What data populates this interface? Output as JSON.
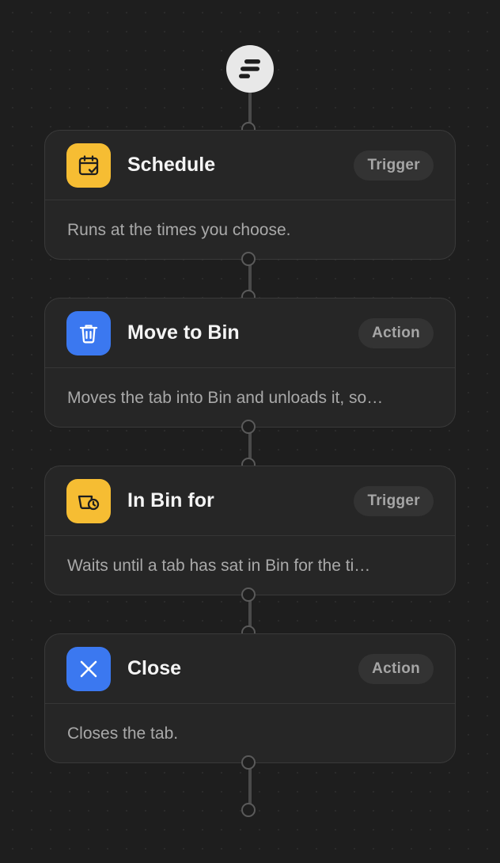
{
  "colors": {
    "background": "#1e1e1e",
    "card": "#262626",
    "trigger_icon": "#f6bd33",
    "action_icon": "#3b78f0"
  },
  "start_node": {
    "icon": "lines-logo-icon"
  },
  "steps": [
    {
      "title": "Schedule",
      "badge": "Trigger",
      "description": "Runs at the times you choose.",
      "icon": "calendar-check-icon",
      "icon_color": "#f6bd33"
    },
    {
      "title": "Move to Bin",
      "badge": "Action",
      "description": "Moves the tab into Bin and unloads it, so…",
      "icon": "trash-icon",
      "icon_color": "#3b78f0"
    },
    {
      "title": "In Bin for",
      "badge": "Trigger",
      "description": "Waits until a tab has sat in Bin for the ti…",
      "icon": "bin-clock-icon",
      "icon_color": "#f6bd33"
    },
    {
      "title": "Close",
      "badge": "Action",
      "description": "Closes the tab.",
      "icon": "close-icon",
      "icon_color": "#3b78f0"
    }
  ]
}
